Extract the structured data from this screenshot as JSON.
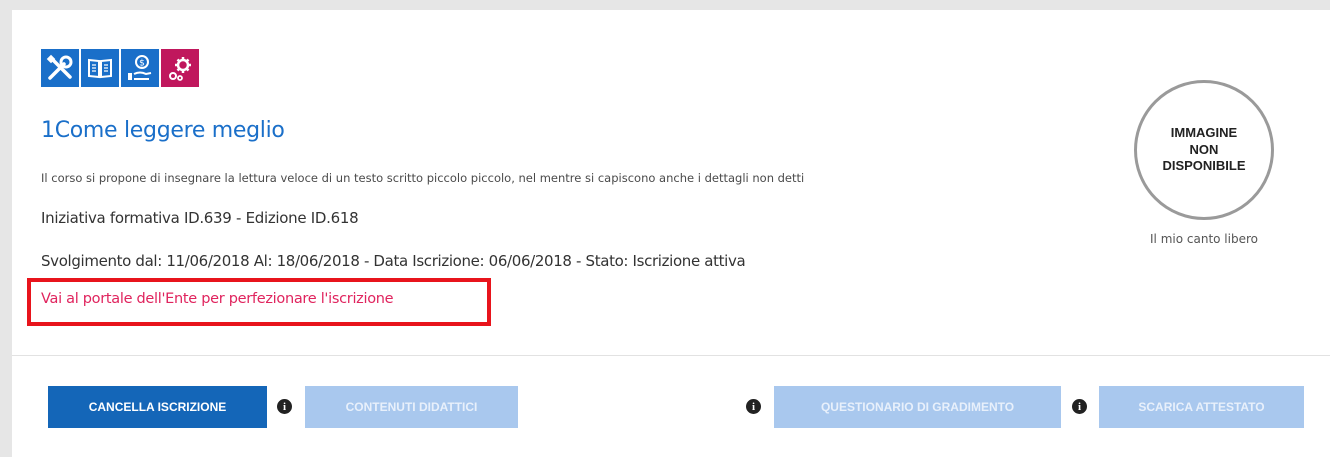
{
  "course": {
    "title": "1Come leggere meglio",
    "description": "Il corso si propone di insegnare la lettura veloce di un testo scritto piccolo piccolo, nel mentre si capiscono anche i dettagli non detti",
    "initiative": "Iniziativa formativa ID.639 - Edizione ID.618",
    "schedule": "Svolgimento dal: 11/06/2018 Al: 18/06/2018 - Data Iscrizione: 06/06/2018 - Stato: Iscrizione attiva",
    "portal_link": "Vai al portale dell'Ente per perfezionare l'iscrizione"
  },
  "image": {
    "placeholder_line1": "IMMAGINE",
    "placeholder_line2": "NON",
    "placeholder_line3": "DISPONIBILE",
    "caption": "Il mio canto libero"
  },
  "icons": [
    "tools-icon",
    "book-icon",
    "money-hand-icon",
    "gears-icon"
  ],
  "colors": {
    "accent": "#1a6fc9",
    "magenta": "#c0175d",
    "link": "#e0245e",
    "highlight": "#e8141c",
    "primary_button": "#1466b8",
    "disabled_button": "#a9c8ee"
  },
  "actions": {
    "cancel": "CANCELLA ISCRIZIONE",
    "content": "CONTENUTI DIDATTICI",
    "survey": "QUESTIONARIO DI GRADIMENTO",
    "certificate": "SCARICA ATTESTATO",
    "info_glyph": "i"
  }
}
